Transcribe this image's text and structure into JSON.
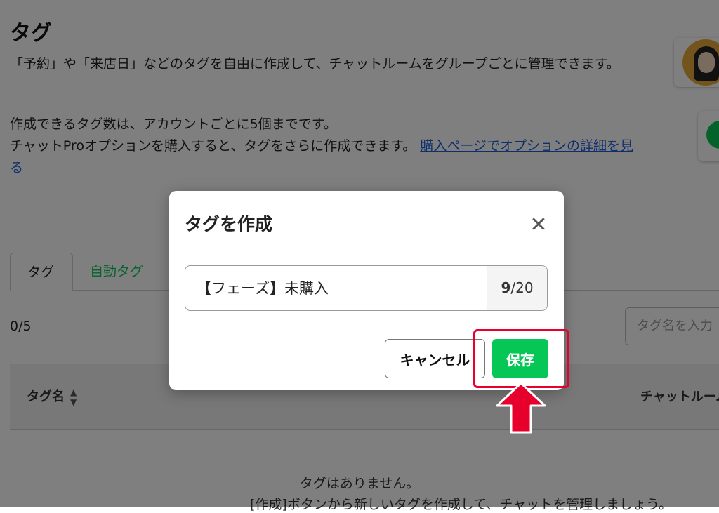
{
  "page": {
    "title": "タグ",
    "description": "「予約」や「来店日」などのタグを自由に作成して、チャットルームをグループごとに管理できます。",
    "limit_text_1": "作成できるタグ数は、アカウントごとに5個までです。",
    "limit_text_2": "チャットProオプションを購入すると、タグをさらに作成できます。",
    "purchase_link": "購入ページでオプションの詳細を見る"
  },
  "tabs": [
    {
      "label": "タグ",
      "active": true
    },
    {
      "label": "自動タグ",
      "active": false
    }
  ],
  "list": {
    "count": "0/5",
    "search_placeholder": "タグ名を入力",
    "columns": [
      "タグ名",
      "チャットルーム"
    ],
    "empty_title": "タグはありません。",
    "empty_hint": "[作成]ボタンから新しいタグを作成して、チャットを管理しましょう。"
  },
  "modal": {
    "title": "タグを作成",
    "input_value": "【フェーズ】未購入",
    "counter_current": "9",
    "counter_max": "/20",
    "cancel_label": "キャンセル",
    "save_label": "保存"
  },
  "colors": {
    "accent_green": "#06c755",
    "link_blue": "#1f5fd9",
    "annotation_red": "#e8002d"
  }
}
